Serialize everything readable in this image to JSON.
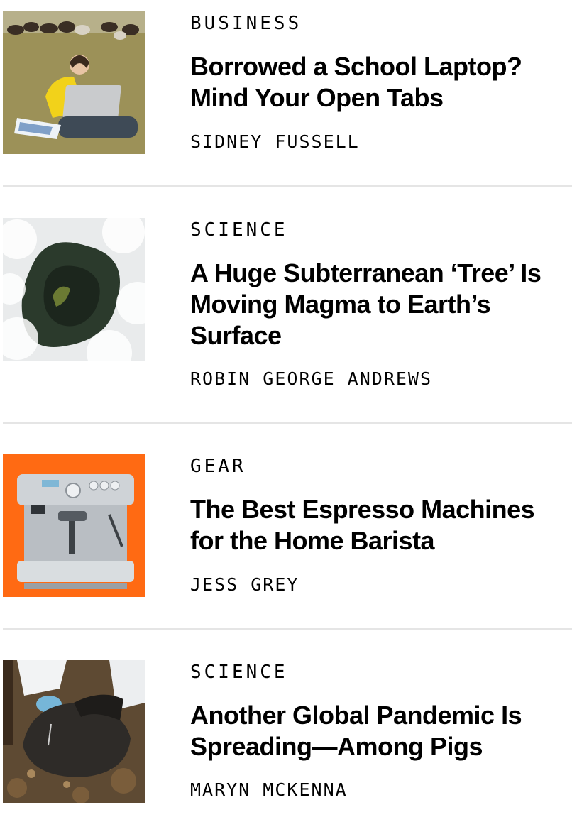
{
  "articles": [
    {
      "category": "BUSINESS",
      "title": "Borrowed a School Laptop? Mind Your Open Tabs",
      "author": "SIDNEY FUSSELL",
      "image": "girl-with-laptop-in-field-photo"
    },
    {
      "category": "SCIENCE",
      "title": "A Huge Subterranean ‘Tree’ Is Moving Magma to Earth’s Surface",
      "author": "ROBIN GEORGE ANDREWS",
      "image": "volcanic-vent-steam-photo"
    },
    {
      "category": "GEAR",
      "title": "The Best Espresso Machines for the Home Barista",
      "author": "JESS GREY",
      "image": "espresso-machine-photo"
    },
    {
      "category": "SCIENCE",
      "title": "Another Global Pandemic Is Spreading—Among Pigs",
      "author": "MARYN MCKENNA",
      "image": "dead-pig-sampling-photo"
    }
  ],
  "colors": {
    "divider": "#e5e5e5",
    "gear_background": "#ff6a13"
  }
}
